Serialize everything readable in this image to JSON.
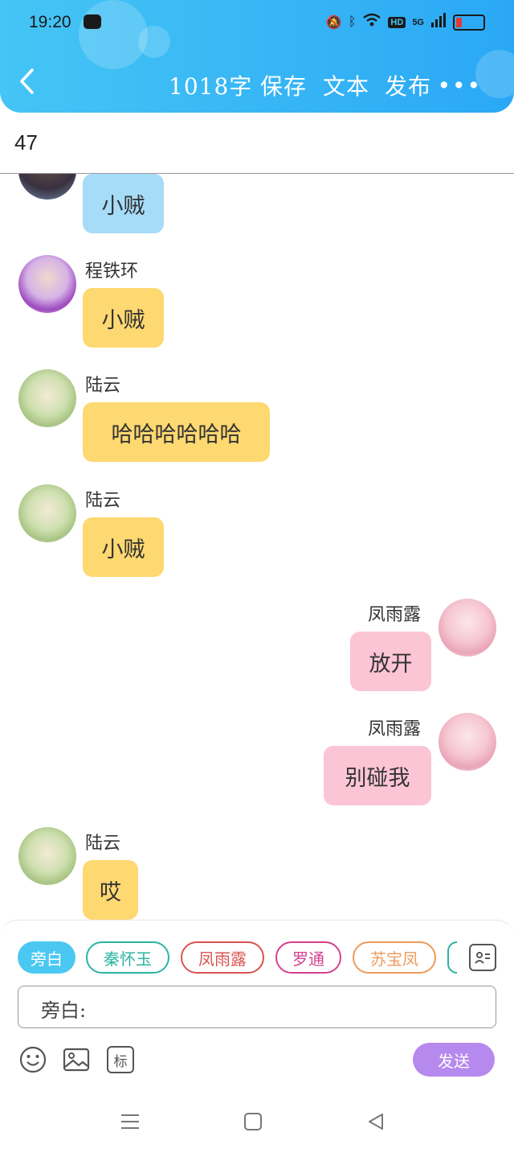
{
  "status_bar": {
    "time": "19:20",
    "network": "5G"
  },
  "toolbar": {
    "word_count": "1018字",
    "save": "保存",
    "text": "文本",
    "publish": "发布"
  },
  "chapter": {
    "number": "47"
  },
  "messages": [
    {
      "speaker": "",
      "text": "小贼",
      "side": "left",
      "color": "#a6dcf8",
      "avatar": "male-portrait-avatar"
    },
    {
      "speaker": "程铁环",
      "text": "小贼",
      "side": "left",
      "color": "#fed870",
      "avatar": "purple-dress-avatar"
    },
    {
      "speaker": "陆云",
      "text": "哈哈哈哈哈哈",
      "side": "left",
      "color": "#fed870",
      "avatar": "garden-lady-avatar"
    },
    {
      "speaker": "陆云",
      "text": "小贼",
      "side": "left",
      "color": "#fed870",
      "avatar": "garden-lady-avatar"
    },
    {
      "speaker": "凤雨露",
      "text": "放开",
      "side": "right",
      "color": "#fcc5d6",
      "avatar": "pink-lady-avatar"
    },
    {
      "speaker": "凤雨露",
      "text": "别碰我",
      "side": "right",
      "color": "#fcc5d6",
      "avatar": "pink-lady-avatar"
    },
    {
      "speaker": "陆云",
      "text": "哎",
      "side": "left",
      "color": "#fed870",
      "avatar": "garden-lady-avatar"
    }
  ],
  "characters": [
    {
      "label": "旁白",
      "color": "#4bc8f2",
      "active": true
    },
    {
      "label": "秦怀玉",
      "color": "#2bb5a0",
      "active": false
    },
    {
      "label": "凤雨露",
      "color": "#d9534f",
      "active": false
    },
    {
      "label": "罗通",
      "color": "#d6418e",
      "active": false
    },
    {
      "label": "苏宝凤",
      "color": "#ef9a5a",
      "active": false
    }
  ],
  "composer": {
    "prefix": "旁白:",
    "send_label": "发送",
    "tag_label": "标"
  }
}
